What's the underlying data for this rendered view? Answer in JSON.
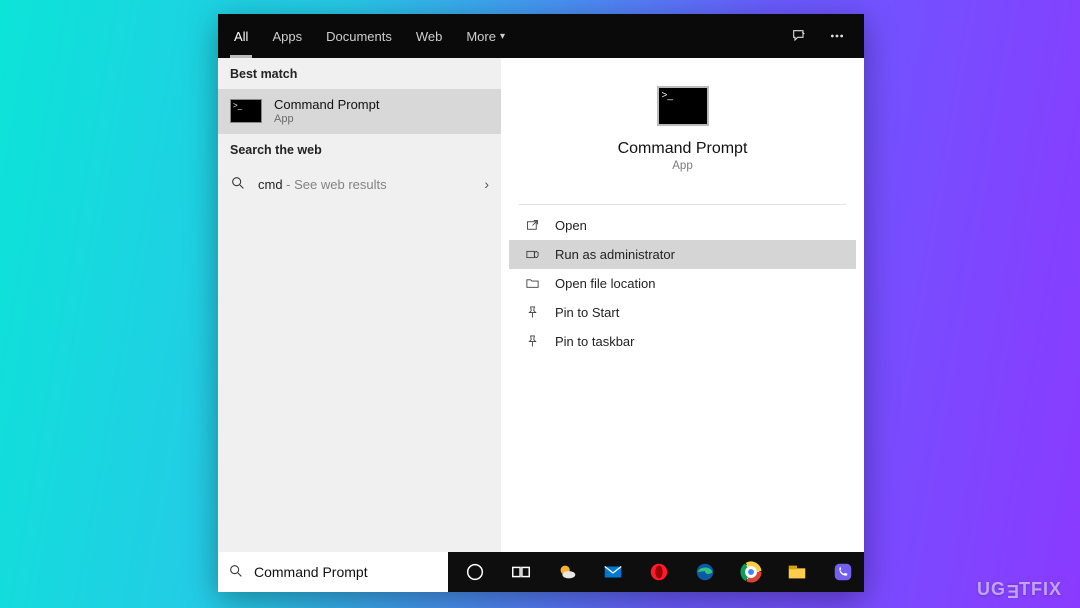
{
  "topbar": {
    "tabs": [
      {
        "label": "All",
        "active": true
      },
      {
        "label": "Apps",
        "active": false
      },
      {
        "label": "Documents",
        "active": false
      },
      {
        "label": "Web",
        "active": false
      },
      {
        "label": "More",
        "active": false,
        "dropdown": true
      }
    ]
  },
  "left": {
    "section_best": "Best match",
    "best": {
      "title": "Command Prompt",
      "subtitle": "App"
    },
    "section_web": "Search the web",
    "web": {
      "query": "cmd",
      "suffix": " - See web results"
    }
  },
  "preview": {
    "title": "Command Prompt",
    "subtitle": "App",
    "actions": [
      {
        "id": "open",
        "label": "Open",
        "icon": "open",
        "selected": false
      },
      {
        "id": "run-admin",
        "label": "Run as administrator",
        "icon": "admin",
        "selected": true
      },
      {
        "id": "open-location",
        "label": "Open file location",
        "icon": "folder",
        "selected": false
      },
      {
        "id": "pin-start",
        "label": "Pin to Start",
        "icon": "pin",
        "selected": false
      },
      {
        "id": "pin-taskbar",
        "label": "Pin to taskbar",
        "icon": "pin",
        "selected": false
      }
    ]
  },
  "search": {
    "value": "Command Prompt"
  },
  "taskbar": {
    "items": [
      {
        "id": "cortana",
        "color": "#ffffff"
      },
      {
        "id": "taskview",
        "color": "#ffffff"
      },
      {
        "id": "weather",
        "color": "#ffb02e"
      },
      {
        "id": "mail",
        "color": "#0078d4"
      },
      {
        "id": "opera",
        "color": "#ff1b2d"
      },
      {
        "id": "edge",
        "color": "#0c59a4"
      },
      {
        "id": "chrome",
        "color": "#ffffff"
      },
      {
        "id": "explorer",
        "color": "#ffcc4d"
      },
      {
        "id": "viber",
        "color": "#7360f2"
      }
    ]
  },
  "watermark": "UGETFIX"
}
